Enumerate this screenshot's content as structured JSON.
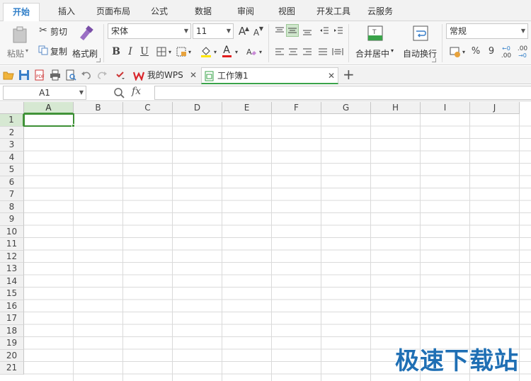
{
  "menu": {
    "tabs": [
      "开始",
      "插入",
      "页面布局",
      "公式",
      "数据",
      "审阅",
      "视图",
      "开发工具",
      "云服务"
    ],
    "active_index": 0
  },
  "ribbon": {
    "paste_label": "粘贴",
    "cut_label": "剪切",
    "copy_label": "复制",
    "format_painter_label": "格式刷",
    "font_name": "宋体",
    "font_size": "11",
    "bold": "B",
    "italic": "I",
    "underline": "U",
    "font_color_letter": "A",
    "grow_font": "A",
    "shrink_font": "A",
    "merge_center_label": "合并居中",
    "wrap_text_label": "自动换行",
    "number_format": "常规",
    "percent": "%",
    "comma": "9",
    "increase_decimal": ".00",
    "decrease_decimal": ".00"
  },
  "doc_tabs": {
    "home_tab": "我的WPS",
    "workbook_tab": "工作簿1",
    "new_tab": "+"
  },
  "formula_bar": {
    "name_box": "A1",
    "fx_label": "fx",
    "formula_value": ""
  },
  "grid": {
    "columns": [
      "A",
      "B",
      "C",
      "D",
      "E",
      "F",
      "G",
      "H",
      "I",
      "J"
    ],
    "rows": [
      "1",
      "2",
      "3",
      "4",
      "5",
      "6",
      "7",
      "8",
      "9",
      "10",
      "11",
      "12",
      "13",
      "14",
      "15",
      "16",
      "17",
      "18",
      "19",
      "20",
      "21"
    ],
    "selected_cell": "A1"
  },
  "watermark": "极速下载站",
  "colors": {
    "accent_green": "#3d8f35",
    "active_tab_text": "#2f7ec8",
    "watermark": "#1f6fb4"
  }
}
